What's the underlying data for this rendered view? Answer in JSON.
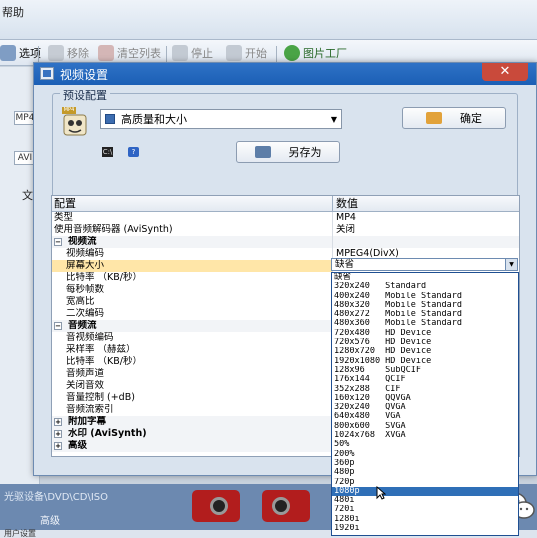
{
  "background": {
    "menu_text": "帮助",
    "toolbar": {
      "options": "选项",
      "remove": "移除",
      "clear_list": "清空列表",
      "stop": "停止",
      "start": "开始",
      "picture_factory": "图片工厂"
    },
    "left_panel": {
      "cells": [
        "MP4",
        "AVI"
      ],
      "text": "文"
    },
    "bottom": {
      "path": "光驱设备\\DVD\\CD\\ISO",
      "advanced": "高级",
      "footer": "用户设置"
    }
  },
  "dialog": {
    "title": "视频设置",
    "close": "✕",
    "preset_group_label": "预设配置",
    "preset_value": "高质量和大小",
    "ok_button": "确定",
    "save_as_button": "另存为",
    "grid": {
      "headers": {
        "config": "配置",
        "value": "数值"
      },
      "rows": [
        {
          "label": "类型",
          "value": "MP4",
          "kind": "plain"
        },
        {
          "label": "使用音频解码器 (AviSynth)",
          "value": "关闭",
          "kind": "plain"
        },
        {
          "label": "视频流",
          "value": "",
          "kind": "group",
          "toggle": "−"
        },
        {
          "label": "视频编码",
          "value": "MPEG4(DivX)",
          "kind": "child"
        },
        {
          "label": "屏幕大小",
          "value": "",
          "kind": "child",
          "selected": true
        },
        {
          "label": "比特率 （KB/秒）",
          "value": "",
          "kind": "child"
        },
        {
          "label": "每秒帧数",
          "value": "",
          "kind": "child"
        },
        {
          "label": "宽高比",
          "value": "",
          "kind": "child"
        },
        {
          "label": "二次编码",
          "value": "",
          "kind": "child"
        },
        {
          "label": "音频流",
          "value": "",
          "kind": "group",
          "toggle": "−"
        },
        {
          "label": "音视频编码",
          "value": "",
          "kind": "child"
        },
        {
          "label": "采样率 （赫兹）",
          "value": "",
          "kind": "child"
        },
        {
          "label": "比特率 （KB/秒）",
          "value": "",
          "kind": "child"
        },
        {
          "label": "音频声道",
          "value": "",
          "kind": "child"
        },
        {
          "label": "关闭音效",
          "value": "",
          "kind": "child"
        },
        {
          "label": "音量控制 (+dB)",
          "value": "",
          "kind": "child"
        },
        {
          "label": "音频流索引",
          "value": "",
          "kind": "child"
        },
        {
          "label": "附加字幕",
          "value": "",
          "kind": "group",
          "toggle": "+"
        },
        {
          "label": "水印 (AviSynth)",
          "value": "",
          "kind": "group",
          "toggle": "+"
        },
        {
          "label": "高级",
          "value": "",
          "kind": "group",
          "toggle": "+"
        }
      ]
    },
    "screen_size_combo": {
      "value": "缺省"
    },
    "screen_size_options": [
      "缺省",
      "320x240   Standard",
      "400x240   Mobile Standard",
      "480x320   Mobile Standard",
      "480x272   Mobile Standard",
      "480x360   Mobile Standard",
      "720x480   HD Device",
      "720x576   HD Device",
      "1280x720  HD Device",
      "1920x1080 HD Device",
      "128x96    SubQCIF",
      "176x144   QCIF",
      "352x288   CIF",
      "160x120   QQVGA",
      "320x240   QVGA",
      "640x480   VGA",
      "800x600   SVGA",
      "1024x768  XVGA",
      "50%",
      "200%",
      "360p",
      "480p",
      "720p",
      "1080p",
      "480i",
      "720i",
      "1280i",
      "1920i"
    ],
    "selected_option_index": 23
  },
  "colors": {
    "title_bar": "#1f63b8",
    "selection": "#2f6fb7",
    "highlight_row": "#ffe6a8",
    "dialog_bg": "#d9e3ee"
  }
}
